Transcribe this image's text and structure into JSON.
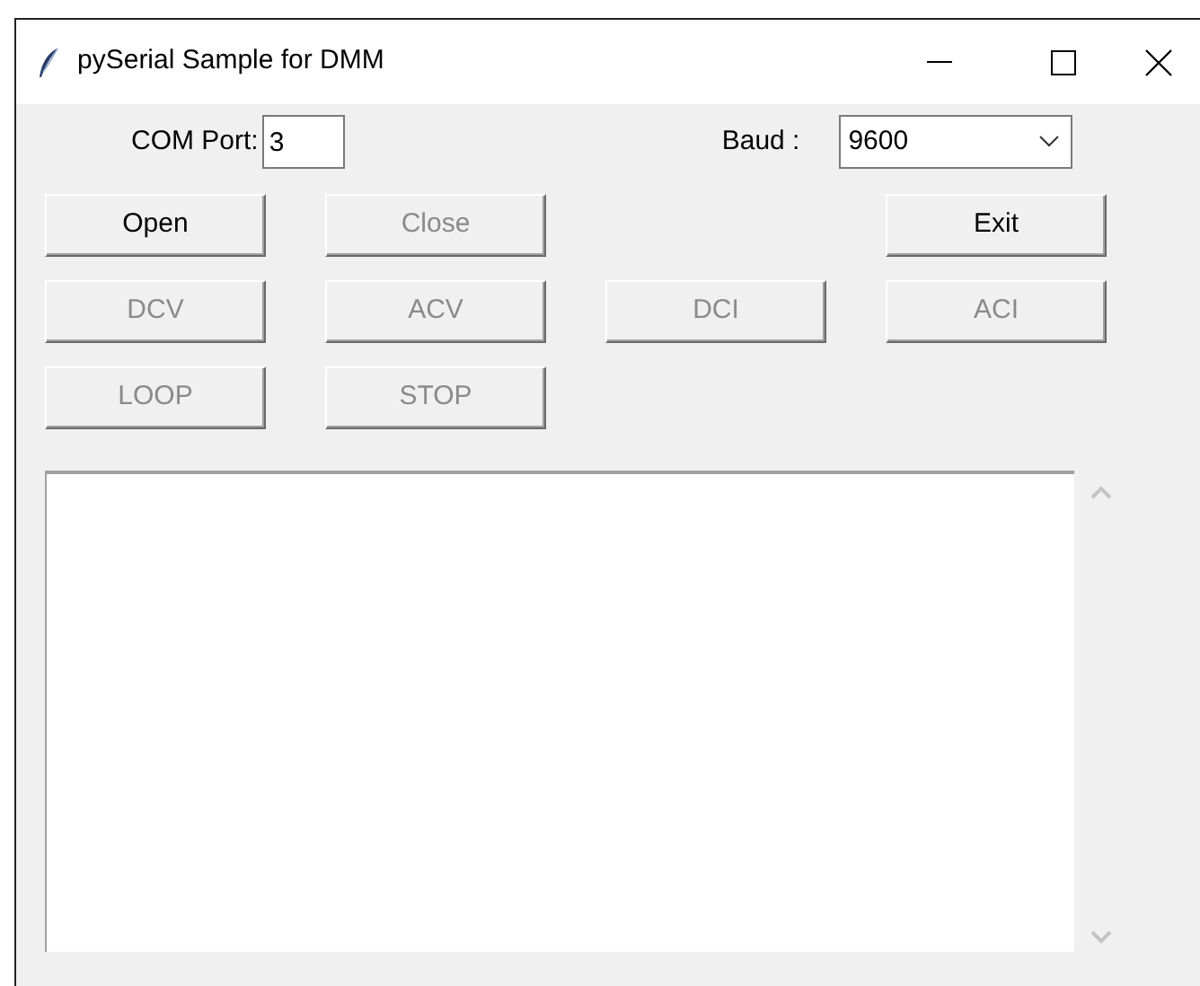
{
  "window": {
    "title": "pySerial Sample for DMM"
  },
  "com_port": {
    "label": "COM Port:",
    "value": "3"
  },
  "baud": {
    "label": "Baud :",
    "value": "9600"
  },
  "button_rows": [
    [
      {
        "label": "Open",
        "disabled": false
      },
      {
        "label": "Close",
        "disabled": true
      },
      null,
      {
        "label": "Exit",
        "disabled": false
      }
    ],
    [
      {
        "label": "DCV",
        "disabled": true
      },
      {
        "label": "ACV",
        "disabled": true
      },
      {
        "label": "DCI",
        "disabled": true
      },
      {
        "label": "ACI",
        "disabled": true
      }
    ],
    [
      {
        "label": "LOOP",
        "disabled": true
      },
      {
        "label": "STOP",
        "disabled": true
      },
      null,
      null
    ]
  ]
}
